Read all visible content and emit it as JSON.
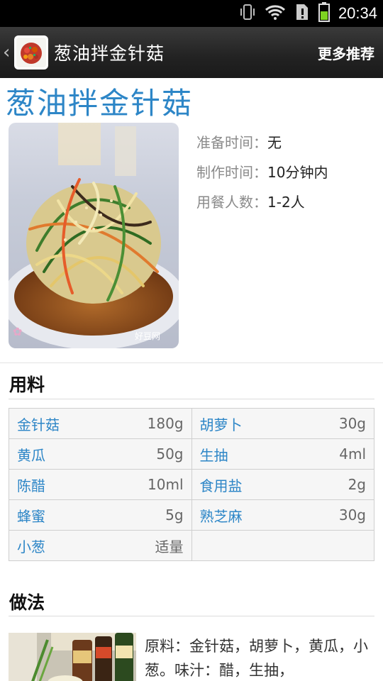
{
  "status_bar": {
    "time": "20:34",
    "icons": [
      "vibrate-icon",
      "wifi-icon",
      "sim-alert-icon",
      "battery-icon"
    ]
  },
  "action_bar": {
    "title": "葱油拌金针菇",
    "more_label": "更多推荐",
    "back_icon": "chevron-left-icon"
  },
  "recipe": {
    "title": "葱油拌金针菇",
    "meta": [
      {
        "label": "准备时间：",
        "value": "无"
      },
      {
        "label": "制作时间：",
        "value": "10分钟内"
      },
      {
        "label": "用餐人数：",
        "value": "1-2人"
      }
    ],
    "photo_watermark": "好豆网"
  },
  "ingredients": {
    "title": "用料",
    "rows": [
      [
        {
          "name": "金针菇",
          "qty": "180g"
        },
        {
          "name": "胡萝卜",
          "qty": "30g"
        }
      ],
      [
        {
          "name": "黄瓜",
          "qty": "50g"
        },
        {
          "name": "生抽",
          "qty": "4ml"
        }
      ],
      [
        {
          "name": "陈醋",
          "qty": "10ml"
        },
        {
          "name": "食用盐",
          "qty": "2g"
        }
      ],
      [
        {
          "name": "蜂蜜",
          "qty": "5g"
        },
        {
          "name": "熟芝麻",
          "qty": "30g"
        }
      ],
      [
        {
          "name": "小葱",
          "qty": "适量"
        },
        {
          "name": "",
          "qty": ""
        }
      ]
    ]
  },
  "method": {
    "title": "做法",
    "step_text": "原料：金针菇，胡萝卜，黄瓜，小葱。味汁：醋，生抽，"
  }
}
